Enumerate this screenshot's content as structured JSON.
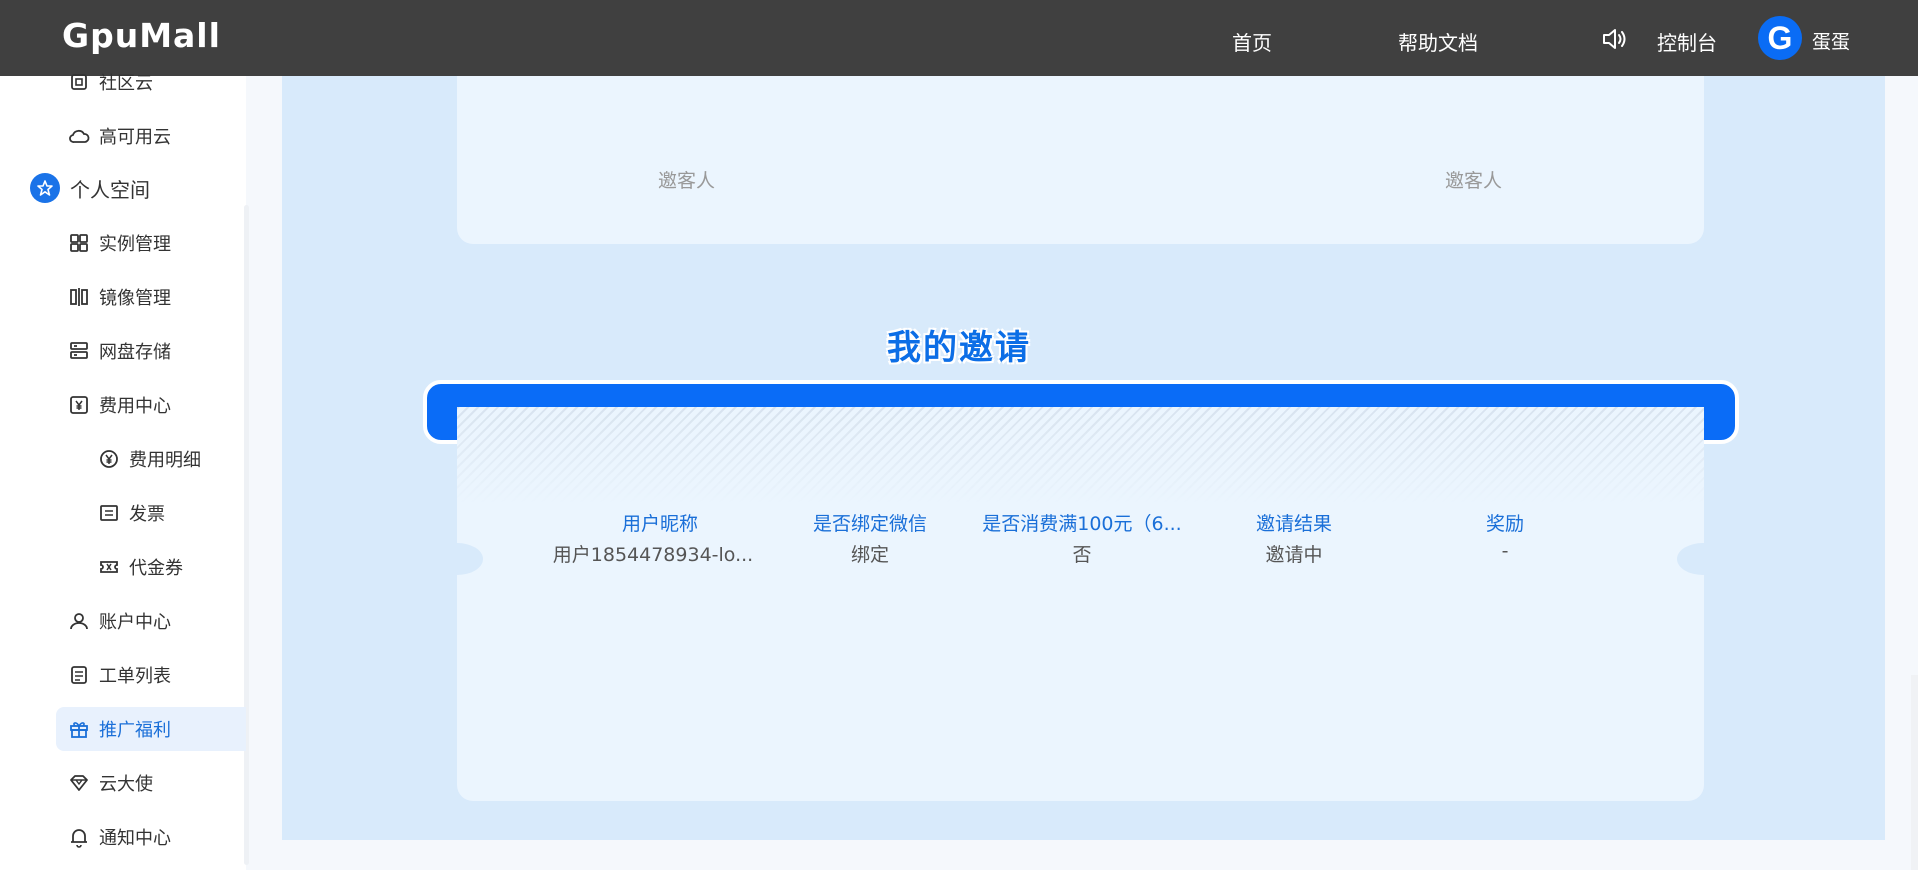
{
  "header": {
    "logo": "GpuMall",
    "nav_home": "首页",
    "nav_docs": "帮助文档",
    "nav_console": "控制台",
    "avatar_letter": "G",
    "username": "蛋蛋"
  },
  "sidebar": {
    "items_top": [
      {
        "label": "社区云",
        "icon": "chip-icon"
      },
      {
        "label": "高可用云",
        "icon": "cloud-icon"
      }
    ],
    "section": "个人空间",
    "items": [
      {
        "label": "实例管理",
        "icon": "grid-icon"
      },
      {
        "label": "镜像管理",
        "icon": "mirror-icon"
      },
      {
        "label": "网盘存储",
        "icon": "storage-icon"
      },
      {
        "label": "费用中心",
        "icon": "yuan-box-icon"
      },
      {
        "label": "费用明细",
        "icon": "yuan-circle-icon"
      },
      {
        "label": "发票",
        "icon": "invoice-icon"
      },
      {
        "label": "代金券",
        "icon": "coupon-icon"
      },
      {
        "label": "账户中心",
        "icon": "user-icon"
      },
      {
        "label": "工单列表",
        "icon": "ticket-icon"
      },
      {
        "label": "推广福利",
        "icon": "gift-icon"
      },
      {
        "label": "云大使",
        "icon": "diamond-icon"
      },
      {
        "label": "通知中心",
        "icon": "bell-icon"
      }
    ],
    "active": "推广福利"
  },
  "top_card": {
    "inviter_left": "邀客人",
    "inviter_right": "邀客人"
  },
  "invites": {
    "title": "我的邀请",
    "columns": [
      "用户昵称",
      "是否绑定微信",
      "是否消费满100元（6...",
      "邀请结果",
      "奖励"
    ],
    "rows": [
      [
        "用户1854478934-lo...",
        "绑定",
        "否",
        "邀请中",
        "-"
      ]
    ]
  },
  "colors": {
    "accent": "#0a6cf7",
    "topbar": "#404040",
    "panel": "#d8eafb",
    "card": "#ebf5fe"
  }
}
